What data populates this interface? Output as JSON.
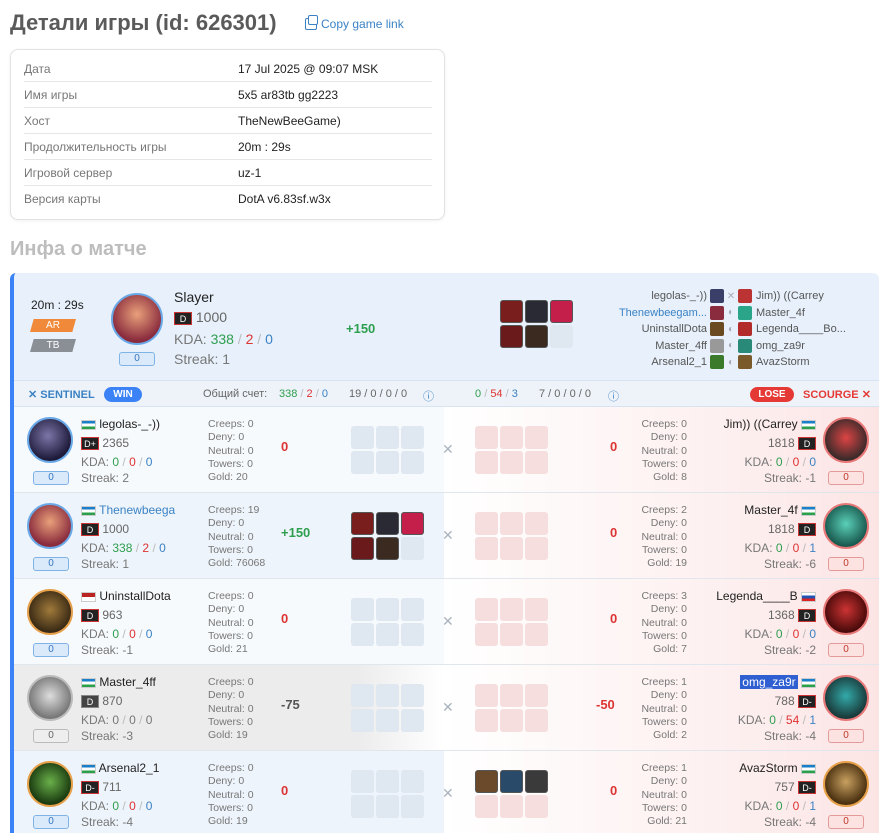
{
  "page": {
    "title": "Детали игры (id: 626301)",
    "copy_link": "Copy game link",
    "section_title": "Инфа о матче"
  },
  "info": [
    {
      "key": "Дата",
      "value": "17 Jul 2025 @ 09:07 MSK"
    },
    {
      "key": "Имя игры",
      "value": "5x5 ar83tb gg2223"
    },
    {
      "key": "Хост",
      "value": "TheNewBeeGame)"
    },
    {
      "key": "Продолжительность игры",
      "value": "20m : 29s"
    },
    {
      "key": "Игровой сервер",
      "value": "uz-1"
    },
    {
      "key": "Версия карты",
      "value": "DotA v6.83sf.w3x"
    }
  ],
  "top": {
    "duration": "20m : 29s",
    "tag1": "AR",
    "tag2": "TB",
    "level": "0",
    "player": "Slayer",
    "rank": "D",
    "rating": "1000",
    "kda_label": "KDA:",
    "kills": "338",
    "deaths": "2",
    "assists": "0",
    "streak": "Streak: 1",
    "gain": "+150",
    "lineup": [
      {
        "left": "legolas-_-))",
        "right": "Jim)) ((Carrey"
      },
      {
        "left": "Thenewbeegam...",
        "right": "Master_4f"
      },
      {
        "left": "UninstallDota",
        "right": "Legenda____Bo..."
      },
      {
        "left": "Master_4ff",
        "right": "omg_za9r"
      },
      {
        "left": "Arsenal2_1",
        "right": "AvazStorm"
      }
    ]
  },
  "bar": {
    "sentinel": "SENTINEL",
    "win": "WIN",
    "score_label": "Общий счет:",
    "s_k": "338",
    "s_d": "2",
    "s_a": "0",
    "s_rest": "19 / 0 / 0 / 0",
    "c_k": "0",
    "c_d": "54",
    "c_a": "3",
    "c_rest": "7 / 0 / 0 / 0",
    "lose": "LOSE",
    "scourge": "SCOURGE"
  },
  "labels": {
    "creeps": "Creeps:",
    "deny": "Deny:",
    "neutral": "Neutral:",
    "towers": "Towers:",
    "gold": "Gold:",
    "kda": "KDA:"
  },
  "rows": [
    {
      "l": {
        "name": "legolas-_-))",
        "rank": "D+",
        "rating": "2365",
        "k": "0",
        "d": "0",
        "a": "0",
        "streak": "Streak: 2",
        "lvl": "0",
        "creeps": "0",
        "deny": "0",
        "neutral": "0",
        "towers": "0",
        "gold": "20",
        "gain": "0"
      },
      "r": {
        "name": "Jim)) ((Carrey",
        "rank": "D",
        "rating": "1818",
        "k": "0",
        "d": "0",
        "a": "0",
        "streak": "Streak: -1",
        "lvl": "0",
        "creeps": "0",
        "deny": "0",
        "neutral": "0",
        "towers": "0",
        "gold": "8",
        "gain": "0"
      }
    },
    {
      "l": {
        "name": "Thenewbeega",
        "rank": "D",
        "rating": "1000",
        "k": "338",
        "d": "2",
        "a": "0",
        "streak": "Streak: 1",
        "lvl": "0",
        "creeps": "19",
        "deny": "0",
        "neutral": "0",
        "towers": "0",
        "gold": "76068",
        "gain": "+150"
      },
      "r": {
        "name": "Master_4f",
        "rank": "D",
        "rating": "1818",
        "k": "0",
        "d": "0",
        "a": "1",
        "streak": "Streak: -6",
        "lvl": "0",
        "creeps": "2",
        "deny": "0",
        "neutral": "0",
        "towers": "0",
        "gold": "19",
        "gain": "0"
      }
    },
    {
      "l": {
        "name": "UninstallDota",
        "rank": "D",
        "rating": "963",
        "k": "0",
        "d": "0",
        "a": "0",
        "streak": "Streak: -1",
        "lvl": "0",
        "creeps": "0",
        "deny": "0",
        "neutral": "0",
        "towers": "0",
        "gold": "21",
        "gain": "0"
      },
      "r": {
        "name": "Legenda____B",
        "rank": "D",
        "rating": "1368",
        "k": "0",
        "d": "0",
        "a": "0",
        "streak": "Streak: -2",
        "lvl": "0",
        "creeps": "3",
        "deny": "0",
        "neutral": "0",
        "towers": "0",
        "gold": "7",
        "gain": "0"
      }
    },
    {
      "l": {
        "name": "Master_4ff",
        "rank": "D",
        "rating": "870",
        "k": "0",
        "d": "0",
        "a": "0",
        "streak": "Streak: -3",
        "lvl": "0",
        "creeps": "0",
        "deny": "0",
        "neutral": "0",
        "towers": "0",
        "gold": "19",
        "gain": "-75"
      },
      "r": {
        "name": "omg_za9r",
        "rank": "D-",
        "rating": "788",
        "k": "0",
        "d": "54",
        "a": "1",
        "streak": "Streak: -4",
        "lvl": "0",
        "creeps": "1",
        "deny": "0",
        "neutral": "0",
        "towers": "0",
        "gold": "2",
        "gain": "-50"
      }
    },
    {
      "l": {
        "name": "Arsenal2_1",
        "rank": "D-",
        "rating": "711",
        "k": "0",
        "d": "0",
        "a": "0",
        "streak": "Streak: -4",
        "lvl": "0",
        "creeps": "0",
        "deny": "0",
        "neutral": "0",
        "towers": "0",
        "gold": "19",
        "gain": "0"
      },
      "r": {
        "name": "AvazStorm",
        "rank": "D-",
        "rating": "757",
        "k": "0",
        "d": "0",
        "a": "1",
        "streak": "Streak: -4",
        "lvl": "0",
        "creeps": "1",
        "deny": "0",
        "neutral": "0",
        "towers": "0",
        "gold": "21",
        "gain": "0"
      }
    }
  ]
}
